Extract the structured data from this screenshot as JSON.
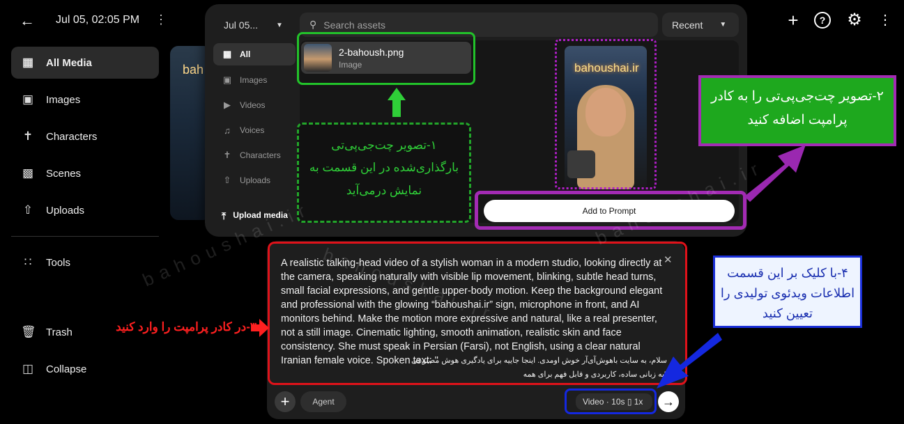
{
  "header": {
    "back_icon": "arrow-left-icon",
    "date": "Jul 05, 02:05 PM",
    "right_icons": [
      "plus-icon",
      "help-icon",
      "gear-icon",
      "kebab-icon"
    ]
  },
  "sidebar": {
    "items": [
      {
        "label": "All Media",
        "icon": "grid-icon",
        "active": true
      },
      {
        "label": "Images",
        "icon": "image-icon"
      },
      {
        "label": "Characters",
        "icon": "person-icon"
      },
      {
        "label": "Scenes",
        "icon": "clapper-icon"
      },
      {
        "label": "Uploads",
        "icon": "upload-folder-icon"
      }
    ],
    "tools": "Tools",
    "trash": "Trash",
    "collapse": "Collapse"
  },
  "background_preview": {
    "text": "bah"
  },
  "picker": {
    "date_select": "Jul 05...",
    "search_placeholder": "Search assets",
    "sort": "Recent",
    "nav": [
      {
        "label": "All",
        "icon": "grid-icon",
        "active": true
      },
      {
        "label": "Images",
        "icon": "image-icon"
      },
      {
        "label": "Videos",
        "icon": "video-icon"
      },
      {
        "label": "Voices",
        "icon": "voice-icon"
      },
      {
        "label": "Characters",
        "icon": "person-icon"
      },
      {
        "label": "Uploads",
        "icon": "upload-folder-icon"
      }
    ],
    "upload_label": "Upload media",
    "asset": {
      "name": "2-bahoush.png",
      "type": "Image"
    },
    "preview_text": "bahoushai.ir",
    "add_to_prompt": "Add to Prompt"
  },
  "annotations": {
    "step1": "۱-تصویر چت‌جی‌پی‌تی بارگذاری‌شده در این قسمت به نمایش درمی‌آید",
    "step2": "۲-تصویر چت‌جی‌پی‌تی را به کادر پرامپت اضافه کنید",
    "step3": "۳-در کادر پرامپت را وارد کنید",
    "step4": "۴-با کلیک بر این قسمت اطلاعات ویدئوی تولیدی را تعیین کنید",
    "watermark": "bahoushai.ir",
    "colors": {
      "green": "#22c22a",
      "purple": "#a32bb4",
      "red": "#e0121a",
      "blue": "#1428e0"
    }
  },
  "prompt": {
    "text": "A realistic talking-head video of a stylish woman in a modern studio, looking directly at the camera, speaking naturally with visible lip movement, blinking, subtle head turns, small facial expressions, and gentle upper-body motion. Keep the background elegant and professional with the glowing “bahoushai.ir” sign, microphone in front, and AI monitors behind. Make the motion more expressive and natural, like a real presenter, not a still image. Cinematic lighting, smooth animation, realistic skin and face consistency. She must speak in Persian (Farsi), not English, using a clear natural Iranian female voice. Spoken text: \"",
    "text_fa_1": "سلام، به سایت باهوش‌آی‌آر خوش اومدی. اینجا جاییه برای یادگیری هوش مصنوعی",
    "text_fa_2": "\"به زبانی ساده، کاربردی و قابل فهم برای همه",
    "agent": "Agent",
    "video_settings": "Video · 10s  ▯  1x",
    "send_icon": "arrow-right-icon"
  }
}
